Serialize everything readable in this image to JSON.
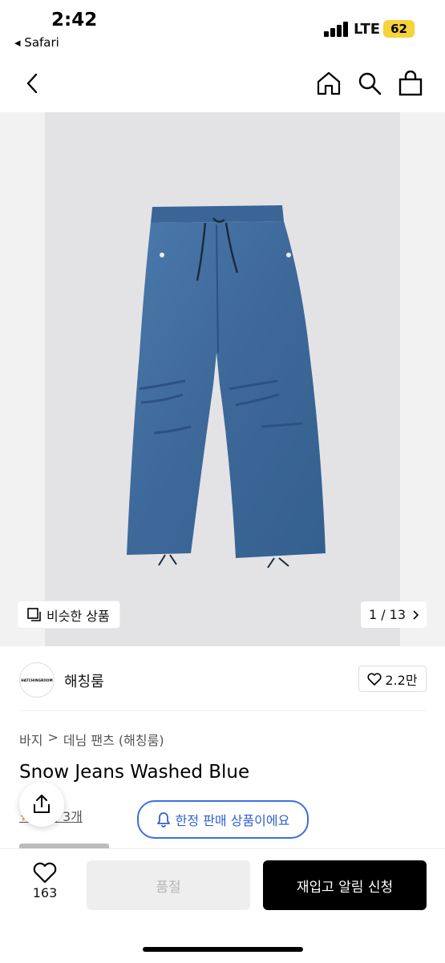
{
  "status": {
    "time": "2:42",
    "back_app": "◂ Safari",
    "network": "LTE",
    "battery": "62"
  },
  "hero": {
    "similar_label": "비슷한 상품",
    "counter": "1 / 13"
  },
  "brand": {
    "logo_text": "HATCHINGROOM",
    "name": "해칭룸",
    "likes": "2.2만"
  },
  "breadcrumb": {
    "level1": "바지",
    "level2": "데님 팬츠 (해칭룸)"
  },
  "product": {
    "name": "Snow Jeans Washed Blue",
    "review_label": "후기 3개",
    "limited_notice": "한정 판매 상품이에요"
  },
  "bottom": {
    "wish_count": "163",
    "soldout_label": "품절",
    "restock_label": "재입고 알림 신청"
  },
  "colors": {
    "accent_blue": "#3a6fe0",
    "battery": "#f5d33a",
    "denim": "#3f6a9b"
  }
}
